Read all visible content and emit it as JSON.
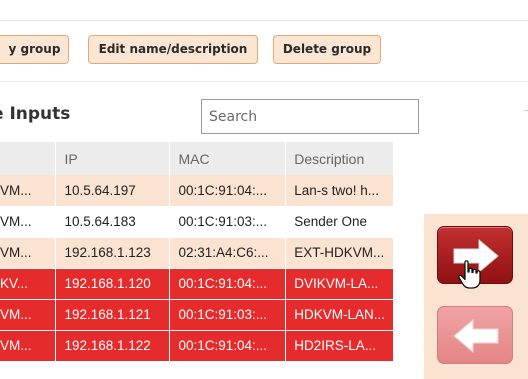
{
  "toolbar": {
    "group_label": "y group",
    "edit_label": "Edit name/description",
    "delete_label": "Delete group"
  },
  "section": {
    "title": "e Inputs",
    "search_placeholder": "Search"
  },
  "table": {
    "columns": [
      "",
      "IP",
      "MAC",
      "Description"
    ],
    "rows": [
      {
        "name": "VM...",
        "ip": "10.5.64.197",
        "mac": "00:1C:91:04:...",
        "desc": "Lan-s two! h...",
        "state": "peach"
      },
      {
        "name": "VM...",
        "ip": "10.5.64.183",
        "mac": "00:1C:91:03:...",
        "desc": "Sender One",
        "state": "white"
      },
      {
        "name": "VM...",
        "ip": "192.168.1.123",
        "mac": "02:31:A4:C6:...",
        "desc": "EXT-HDKVM...",
        "state": "peach"
      },
      {
        "name": "KV...",
        "ip": "192.168.1.120",
        "mac": "00:1C:91:04:...",
        "desc": "DVIKVM-LA...",
        "state": "selected"
      },
      {
        "name": "VM...",
        "ip": "192.168.1.121",
        "mac": "00:1C:91:03:...",
        "desc": "HDKVM-LAN...",
        "state": "selected"
      },
      {
        "name": "VM...",
        "ip": "192.168.1.122",
        "mac": "00:1C:91:04:...",
        "desc": "HD2IRS-LA...",
        "state": "selected"
      }
    ]
  },
  "icons": {
    "move_right": "arrow-right-icon",
    "move_left": "arrow-left-icon",
    "cursor": "hand-pointer-icon"
  },
  "colors": {
    "button_bg": "#fbe6d4",
    "row_peach": "#fbe3d2",
    "row_selected": "#e52b2b",
    "arrow_active": "#b52424",
    "arrow_disabled": "#ec9696"
  }
}
